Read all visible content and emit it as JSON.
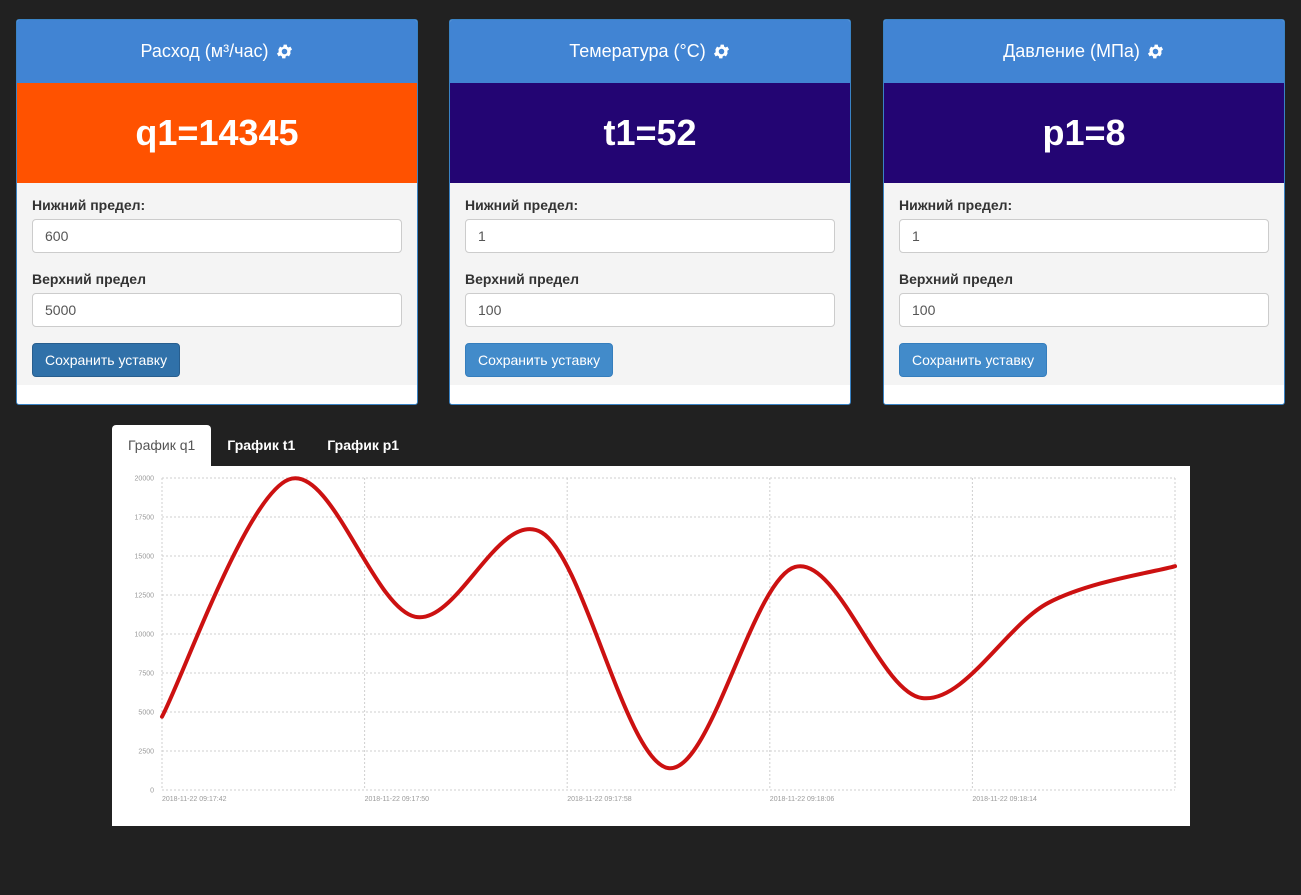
{
  "panels": [
    {
      "title": "Расход (м³/час)",
      "value": "q1=14345",
      "value_color": "#ff5200",
      "lower_label": "Нижний предел:",
      "lower_value": "600",
      "upper_label": "Верхний предел",
      "upper_value": "5000",
      "save_label": "Сохранить уставку"
    },
    {
      "title": "Темература (°C)",
      "value": "t1=52",
      "value_color": "#230573",
      "lower_label": "Нижний предел:",
      "lower_value": "1",
      "upper_label": "Верхний предел",
      "upper_value": "100",
      "save_label": "Сохранить уставку"
    },
    {
      "title": "Давление (МПа)",
      "value": "p1=8",
      "value_color": "#230573",
      "lower_label": "Нижний предел:",
      "lower_value": "1",
      "upper_label": "Верхний предел",
      "upper_value": "100",
      "save_label": "Сохранить уставку"
    }
  ],
  "tabs": [
    {
      "label": "График q1",
      "active": true
    },
    {
      "label": "График t1",
      "active": false
    },
    {
      "label": "График p1",
      "active": false
    }
  ],
  "colors": {
    "background": "#212121",
    "panel_heading": "#4184d3",
    "alert": "#ff5200",
    "normal": "#230573",
    "line": "#cc1111"
  },
  "chart_data": {
    "type": "line",
    "title": "",
    "xlabel": "",
    "ylabel": "",
    "ylim": [
      0,
      20000
    ],
    "yticks": [
      0,
      2500,
      5000,
      7500,
      10000,
      12500,
      15000,
      17500,
      20000
    ],
    "grid": true,
    "xticks": [
      "2018-11-22 09:17:42",
      "2018-11-22 09:17:50",
      "2018-11-22 09:17:58",
      "2018-11-22 09:18:06",
      "2018-11-22 09:18:14"
    ],
    "x": [
      "2018-11-22 09:17:42",
      "2018-11-22 09:17:47",
      "2018-11-22 09:17:52",
      "2018-11-22 09:17:57",
      "2018-11-22 09:18:02",
      "2018-11-22 09:18:07",
      "2018-11-22 09:18:12",
      "2018-11-22 09:18:17",
      "2018-11-22 09:18:22"
    ],
    "series": [
      {
        "values": [
          4700,
          19900,
          11100,
          16500,
          1400,
          14300,
          5900,
          12000,
          14345
        ],
        "color": "#cc1111"
      }
    ]
  }
}
